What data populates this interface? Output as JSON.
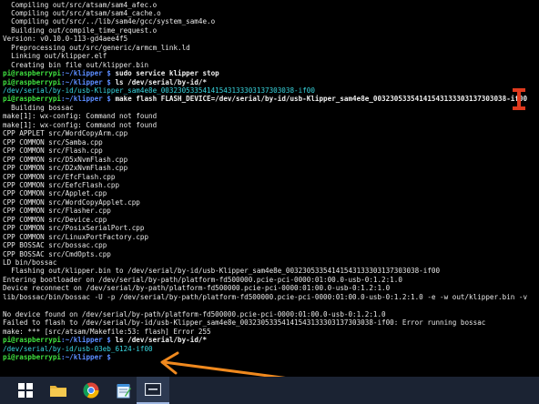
{
  "terminal": {
    "lines": [
      {
        "segments": [
          {
            "t": "  Compiling out/src/atsam/sam4_afec.o",
            "c": ""
          }
        ]
      },
      {
        "segments": [
          {
            "t": "  Compiling out/src/atsam/sam4_cache.o",
            "c": ""
          }
        ]
      },
      {
        "segments": [
          {
            "t": "  Compiling out/src/../lib/sam4e/gcc/system_sam4e.o",
            "c": ""
          }
        ]
      },
      {
        "segments": [
          {
            "t": "  Building out/compile_time_request.o",
            "c": ""
          }
        ]
      },
      {
        "segments": [
          {
            "t": "Version: v0.10.0-113-gd4aee4f5",
            "c": ""
          }
        ]
      },
      {
        "segments": [
          {
            "t": "  Preprocessing out/src/generic/armcm_link.ld",
            "c": ""
          }
        ]
      },
      {
        "segments": [
          {
            "t": "  Linking out/klipper.elf",
            "c": ""
          }
        ]
      },
      {
        "segments": [
          {
            "t": "  Creating bin file out/klipper.bin",
            "c": ""
          }
        ]
      },
      {
        "segments": [
          {
            "t": "pi@raspberrypi",
            "c": "g"
          },
          {
            "t": ":~/klipper $ ",
            "c": "b"
          },
          {
            "t": "sudo service klipper stop",
            "c": "w"
          }
        ]
      },
      {
        "segments": [
          {
            "t": "pi@raspberrypi",
            "c": "g"
          },
          {
            "t": ":~/klipper $ ",
            "c": "b"
          },
          {
            "t": "ls /dev/serial/by-id/*",
            "c": "w"
          }
        ]
      },
      {
        "segments": [
          {
            "t": "/dev/serial/by-id/usb-Klipper_sam4e8e_00323053354141543133303137303038-if00",
            "c": "c"
          }
        ]
      },
      {
        "segments": [
          {
            "t": "pi@raspberrypi",
            "c": "g"
          },
          {
            "t": ":~/klipper $ ",
            "c": "b"
          },
          {
            "t": "make flash FLASH_DEVICE=/dev/serial/by-id/usb-Klipper_sam4e8e_00323053354141543133303137303038-if00",
            "c": "w"
          }
        ]
      },
      {
        "segments": [
          {
            "t": "  Building bossac",
            "c": ""
          }
        ]
      },
      {
        "segments": [
          {
            "t": "make[1]: wx-config: Command not found",
            "c": ""
          }
        ]
      },
      {
        "segments": [
          {
            "t": "make[1]: wx-config: Command not found",
            "c": ""
          }
        ]
      },
      {
        "segments": [
          {
            "t": "CPP APPLET src/WordCopyArm.cpp",
            "c": ""
          }
        ]
      },
      {
        "segments": [
          {
            "t": "CPP COMMON src/Samba.cpp",
            "c": ""
          }
        ]
      },
      {
        "segments": [
          {
            "t": "CPP COMMON src/Flash.cpp",
            "c": ""
          }
        ]
      },
      {
        "segments": [
          {
            "t": "CPP COMMON src/D5xNvmFlash.cpp",
            "c": ""
          }
        ]
      },
      {
        "segments": [
          {
            "t": "CPP COMMON src/D2xNvmFlash.cpp",
            "c": ""
          }
        ]
      },
      {
        "segments": [
          {
            "t": "CPP COMMON src/EfcFlash.cpp",
            "c": ""
          }
        ]
      },
      {
        "segments": [
          {
            "t": "CPP COMMON src/EefcFlash.cpp",
            "c": ""
          }
        ]
      },
      {
        "segments": [
          {
            "t": "CPP COMMON src/Applet.cpp",
            "c": ""
          }
        ]
      },
      {
        "segments": [
          {
            "t": "CPP COMMON src/WordCopyApplet.cpp",
            "c": ""
          }
        ]
      },
      {
        "segments": [
          {
            "t": "CPP COMMON src/Flasher.cpp",
            "c": ""
          }
        ]
      },
      {
        "segments": [
          {
            "t": "CPP COMMON src/Device.cpp",
            "c": ""
          }
        ]
      },
      {
        "segments": [
          {
            "t": "CPP COMMON src/PosixSerialPort.cpp",
            "c": ""
          }
        ]
      },
      {
        "segments": [
          {
            "t": "CPP COMMON src/LinuxPortFactory.cpp",
            "c": ""
          }
        ]
      },
      {
        "segments": [
          {
            "t": "CPP BOSSAC src/bossac.cpp",
            "c": ""
          }
        ]
      },
      {
        "segments": [
          {
            "t": "CPP BOSSAC src/CmdOpts.cpp",
            "c": ""
          }
        ]
      },
      {
        "segments": [
          {
            "t": "LD bin/bossac",
            "c": ""
          }
        ]
      },
      {
        "segments": [
          {
            "t": "  Flashing out/klipper.bin to /dev/serial/by-id/usb-Klipper_sam4e8e_00323053354141543133303137303038-if00",
            "c": ""
          }
        ]
      },
      {
        "segments": [
          {
            "t": "Entering bootloader on /dev/serial/by-path/platform-fd500000.pcie-pci-0000:01:00.0-usb-0:1.2:1.0",
            "c": ""
          }
        ]
      },
      {
        "segments": [
          {
            "t": "Device reconnect on /dev/serial/by-path/platform-fd500000.pcie-pci-0000:01:00.0-usb-0:1.2:1.0",
            "c": ""
          }
        ]
      },
      {
        "segments": [
          {
            "t": "lib/bossac/bin/bossac -U -p /dev/serial/by-path/platform-fd500000.pcie-pci-0000:01:00.0-usb-0:1.2:1.0 -e -w out/klipper.bin -v",
            "c": ""
          }
        ]
      },
      {
        "segments": [
          {
            "t": "",
            "c": ""
          }
        ]
      },
      {
        "segments": [
          {
            "t": "No device found on /dev/serial/by-path/platform-fd500000.pcie-pci-0000:01:00.0-usb-0:1.2:1.0",
            "c": ""
          }
        ]
      },
      {
        "segments": [
          {
            "t": "Failed to flash to /dev/serial/by-id/usb-Klipper_sam4e8e_00323053354141543133303137303038-if00: Error running bossac",
            "c": ""
          }
        ]
      },
      {
        "segments": [
          {
            "t": "make: *** [src/atsam/Makefile:53: flash] Error 255",
            "c": ""
          }
        ]
      },
      {
        "segments": [
          {
            "t": "pi@raspberrypi",
            "c": "g"
          },
          {
            "t": ":~/klipper $ ",
            "c": "b"
          },
          {
            "t": "ls /dev/serial/by-id/*",
            "c": "w"
          }
        ]
      },
      {
        "segments": [
          {
            "t": "/dev/serial/by-id/usb-03eb_6124-if00",
            "c": "c"
          }
        ]
      },
      {
        "segments": [
          {
            "t": "pi@raspberrypi",
            "c": "g"
          },
          {
            "t": ":~/klipper $ ",
            "c": "b"
          },
          {
            "t": "",
            "c": "w"
          }
        ]
      }
    ]
  },
  "annotations": {
    "bracket_color": "#e03a1e",
    "arrow_color": "#f0891e"
  },
  "taskbar": {
    "background": "#1b2333",
    "items": [
      {
        "icon": "windows-start-icon"
      },
      {
        "icon": "file-explorer-icon"
      },
      {
        "icon": "chrome-icon"
      },
      {
        "icon": "notepad-icon"
      },
      {
        "icon": "terminal-window-icon"
      }
    ]
  }
}
